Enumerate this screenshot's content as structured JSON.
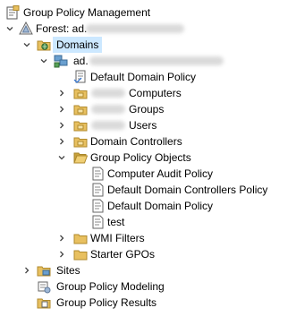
{
  "tree": {
    "root": {
      "label": "Group Policy Management"
    },
    "forest": {
      "label": "Forest: ad."
    },
    "domains": {
      "label": "Domains"
    },
    "domain": {
      "label": "ad."
    },
    "default_domain_policy_link": {
      "label": "Default Domain Policy"
    },
    "ou_computers": {
      "label": "Computers"
    },
    "ou_groups": {
      "label": "Groups"
    },
    "ou_users": {
      "label": "Users"
    },
    "domain_controllers": {
      "label": "Domain Controllers"
    },
    "group_policy_objects": {
      "label": "Group Policy Objects",
      "items": [
        {
          "label": "Computer Audit Policy"
        },
        {
          "label": "Default Domain Controllers Policy"
        },
        {
          "label": "Default Domain Policy"
        },
        {
          "label": "test"
        }
      ]
    },
    "wmi_filters": {
      "label": "WMI Filters"
    },
    "starter_gpos": {
      "label": "Starter GPOs"
    },
    "sites": {
      "label": "Sites"
    },
    "modeling": {
      "label": "Group Policy Modeling"
    },
    "results": {
      "label": "Group Policy Results"
    }
  },
  "icons": {
    "gpm": "group-policy-management-icon",
    "forest": "forest-icon",
    "domains": "domains-icon",
    "domain": "domain-icon",
    "link": "gpo-link-icon",
    "ou": "organizational-unit-icon",
    "folder": "folder-icon",
    "gpo": "gpo-icon",
    "sites": "sites-icon",
    "modeling": "modeling-icon",
    "results": "results-icon"
  },
  "colors": {
    "selection": "#cce8ff",
    "folder": "#e8c060",
    "folder_dark": "#c9a23c",
    "text": "#000000"
  }
}
